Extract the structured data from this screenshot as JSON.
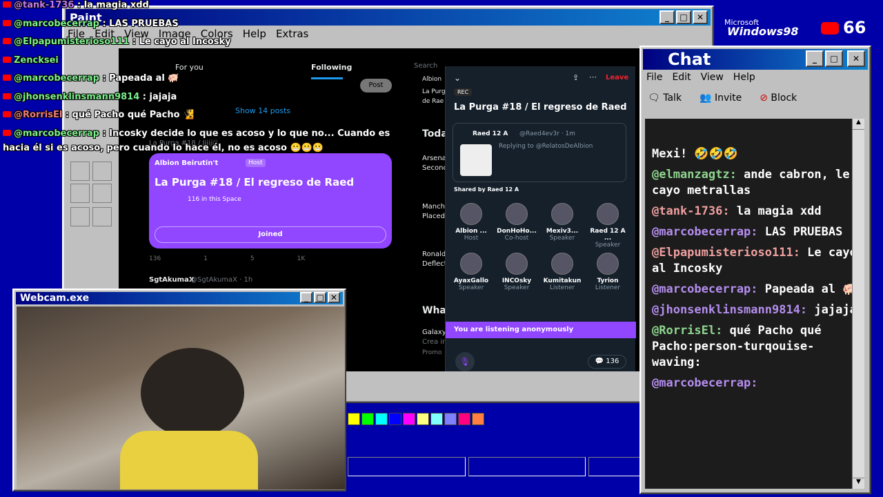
{
  "brand": {
    "ms": "Microsoft",
    "win": "Windows98",
    "sub_count": "66"
  },
  "paint": {
    "title": "Paint",
    "menu": [
      "File",
      "Edit",
      "View",
      "Image",
      "Colors",
      "Help",
      "Extras"
    ],
    "palette": [
      "#ffff00",
      "#00ff00",
      "#00ffff",
      "#0000ff",
      "#ff00ff",
      "#ffff80",
      "#80ffff",
      "#8080ff",
      "#ff0080",
      "#ff8040"
    ]
  },
  "twitter": {
    "tab_for_you": "For you",
    "tab_following": "Following",
    "post": "Post",
    "show_posts": "Show 14 posts",
    "tweet_note": "La Purga #18 / Jijijiji",
    "host_name": "Albion Beirutin't",
    "host_badge": "Host",
    "space_title": "La Purga #18 / El regreso de Raed",
    "in_space": "116 in this Space",
    "joined": "Joined",
    "stat_replies": "136",
    "stat_rt": "1",
    "stat_likes": "5",
    "stat_views": "1K",
    "next_user": "SgtAkumaX",
    "next_handle": "@SgtAkumaX · 1h",
    "side_today": "Today",
    "side_arsenal": "Arsena",
    "side_second": "Second",
    "side_manche": "Manche",
    "side_placed": "Placed",
    "side_ronaldo": "Ronald",
    "side_deflect": "Deflect",
    "side_what": "What",
    "side_galaxy": "Galaxy",
    "side_crea": "Crea im",
    "side_promo": "Promo",
    "search": "Search",
    "side_albion": "Albion",
    "side_purga": "La Purg",
    "side_raed": "de Rae"
  },
  "space": {
    "leave": "Leave",
    "rec": "REC",
    "title": "La Purga #18 / El regreso de Raed",
    "post_user": "Raed 12 A",
    "post_handle": "@Raed4ev3r · 1m",
    "replying": "Replying to @RelatosDeAlbion",
    "shared": "Shared by Raed 12 A",
    "speakers": [
      {
        "n": "Albion ...",
        "r": "Host"
      },
      {
        "n": "DonHoHo...",
        "r": "Co-host"
      },
      {
        "n": "Mexiv3...",
        "r": "Speaker"
      },
      {
        "n": "Raed 12 A ...",
        "r": "Speaker"
      },
      {
        "n": "AyaxGallo",
        "r": "Speaker"
      },
      {
        "n": "INCOsky",
        "r": "Speaker"
      },
      {
        "n": "Kumitakun",
        "r": "Listener"
      },
      {
        "n": "Tyrion",
        "r": "Listener"
      }
    ],
    "listening": "You are listening anonymously",
    "count": "136"
  },
  "webcam": {
    "title": "Webcam.exe"
  },
  "chat": {
    "title": "Chat",
    "menu": [
      "File",
      "Edit",
      "View",
      "Help"
    ],
    "talk": "Talk",
    "invite": "Invite",
    "block": "Block",
    "messages": [
      {
        "u": "",
        "t": "Mexi! 🤣🤣🤣",
        "c": "cn"
      },
      {
        "u": "@elmanzagtz:",
        "t": " ande cabron, le cayo metrallas",
        "c": "cn"
      },
      {
        "u": "@tank-1736:",
        "t": " la magia xdd",
        "c": "cp"
      },
      {
        "u": "@marcobecerrap:",
        "t": " LAS PRUEBAS",
        "c": "cm"
      },
      {
        "u": "@Elpapumisterioso111:",
        "t": " Le cayó al Incosky",
        "c": "cp"
      },
      {
        "u": "@marcobecerrap:",
        "t": " Papeada al 🐖",
        "c": "cm"
      },
      {
        "u": "@jhonsenklinsmann9814:",
        "t": " jajaja",
        "c": "cm"
      },
      {
        "u": "@RorrisEl:",
        "t": " qué Pacho qué Pacho:person-turqouise-waving:",
        "c": "cn"
      },
      {
        "u": "@marcobecerrap:",
        "t": "",
        "c": "cm"
      }
    ]
  },
  "overlay": [
    {
      "n": "@tank-1736",
      "t": " : la magia xdd",
      "c": "nmp"
    },
    {
      "n": "@marcobecerrap",
      "t": " : LAS PRUEBAS",
      "c": "nmg"
    },
    {
      "n": "@Elpapumisterioso111",
      "t": " : Le cayo al Incosky",
      "c": "nmg"
    },
    {
      "n": "Zencksei",
      "t": "",
      "c": "nmg"
    },
    {
      "n": "@marcobecerrap",
      "t": " : Papeada al 🐖",
      "c": "nmg"
    },
    {
      "n": "@jhonsenklinsmann9814",
      "t": " : jajaja",
      "c": "nmg"
    },
    {
      "n": "@RorrisEl",
      "t": " : qué Pacho qué Pacho 🧏",
      "c": "nmr"
    },
    {
      "n": "@marcobecerrap",
      "t": " : Incosky decide lo que es acoso y lo que no... Cuando es",
      "c": "nmg"
    }
  ],
  "overlay_cont": "hacia él si es acoso, pero cuando lo hace él, no es acoso 😬😬😬"
}
